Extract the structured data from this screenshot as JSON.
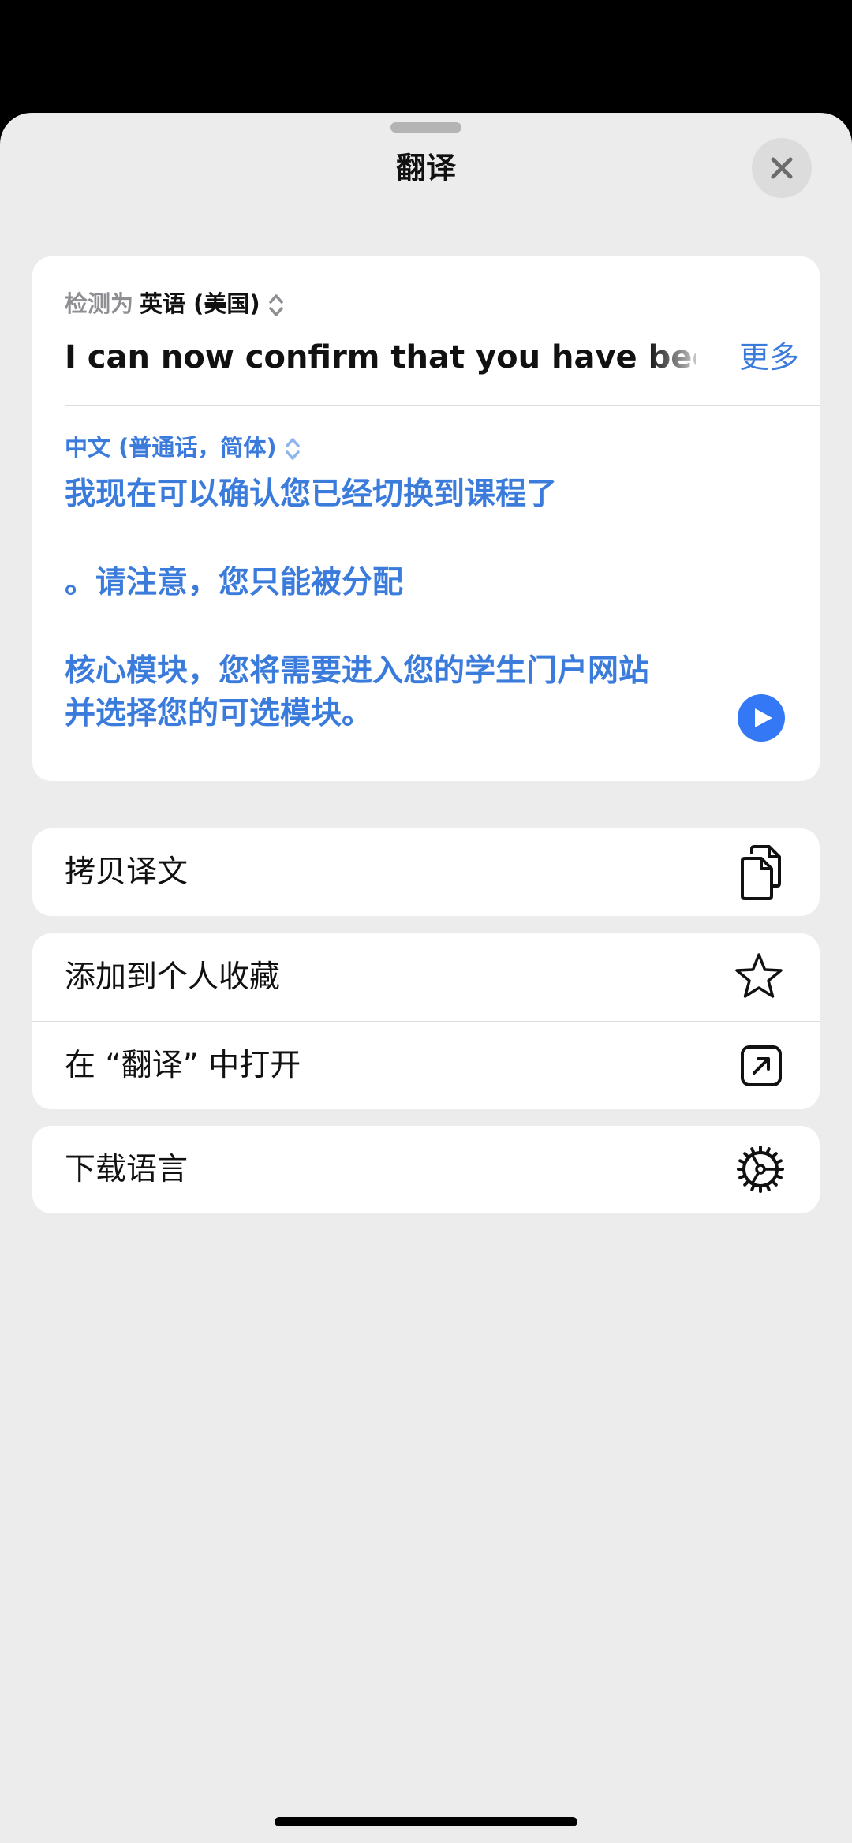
{
  "sheet": {
    "title": "翻译",
    "close_icon": "xmark-icon"
  },
  "translation": {
    "detected_prefix": "检测为",
    "detected_language": "英语 (美国)",
    "source_text": "I can now confirm that you have been",
    "more_label": "更多",
    "target_language": "中文 (普通话，简体)",
    "target_lines": [
      "我现在可以确认您已经切换到课程了",
      "。请注意，您只能被分配",
      "核心模块，您将需要进入您的学生门户网站",
      "并选择您的可选模块。"
    ],
    "play_icon": "play-icon"
  },
  "actions": {
    "copy_label": "拷贝译文",
    "copy_icon": "copy-icon",
    "favorite_label": "添加到个人收藏",
    "favorite_icon": "star-icon",
    "open_label": "在 “翻译” 中打开",
    "open_icon": "arrow-up-right-square-icon",
    "download_label": "下载语言",
    "download_icon": "gear-icon"
  },
  "colors": {
    "accent": "#3a7bdc",
    "sheet_background": "#ececec",
    "card_background": "#ffffff"
  }
}
